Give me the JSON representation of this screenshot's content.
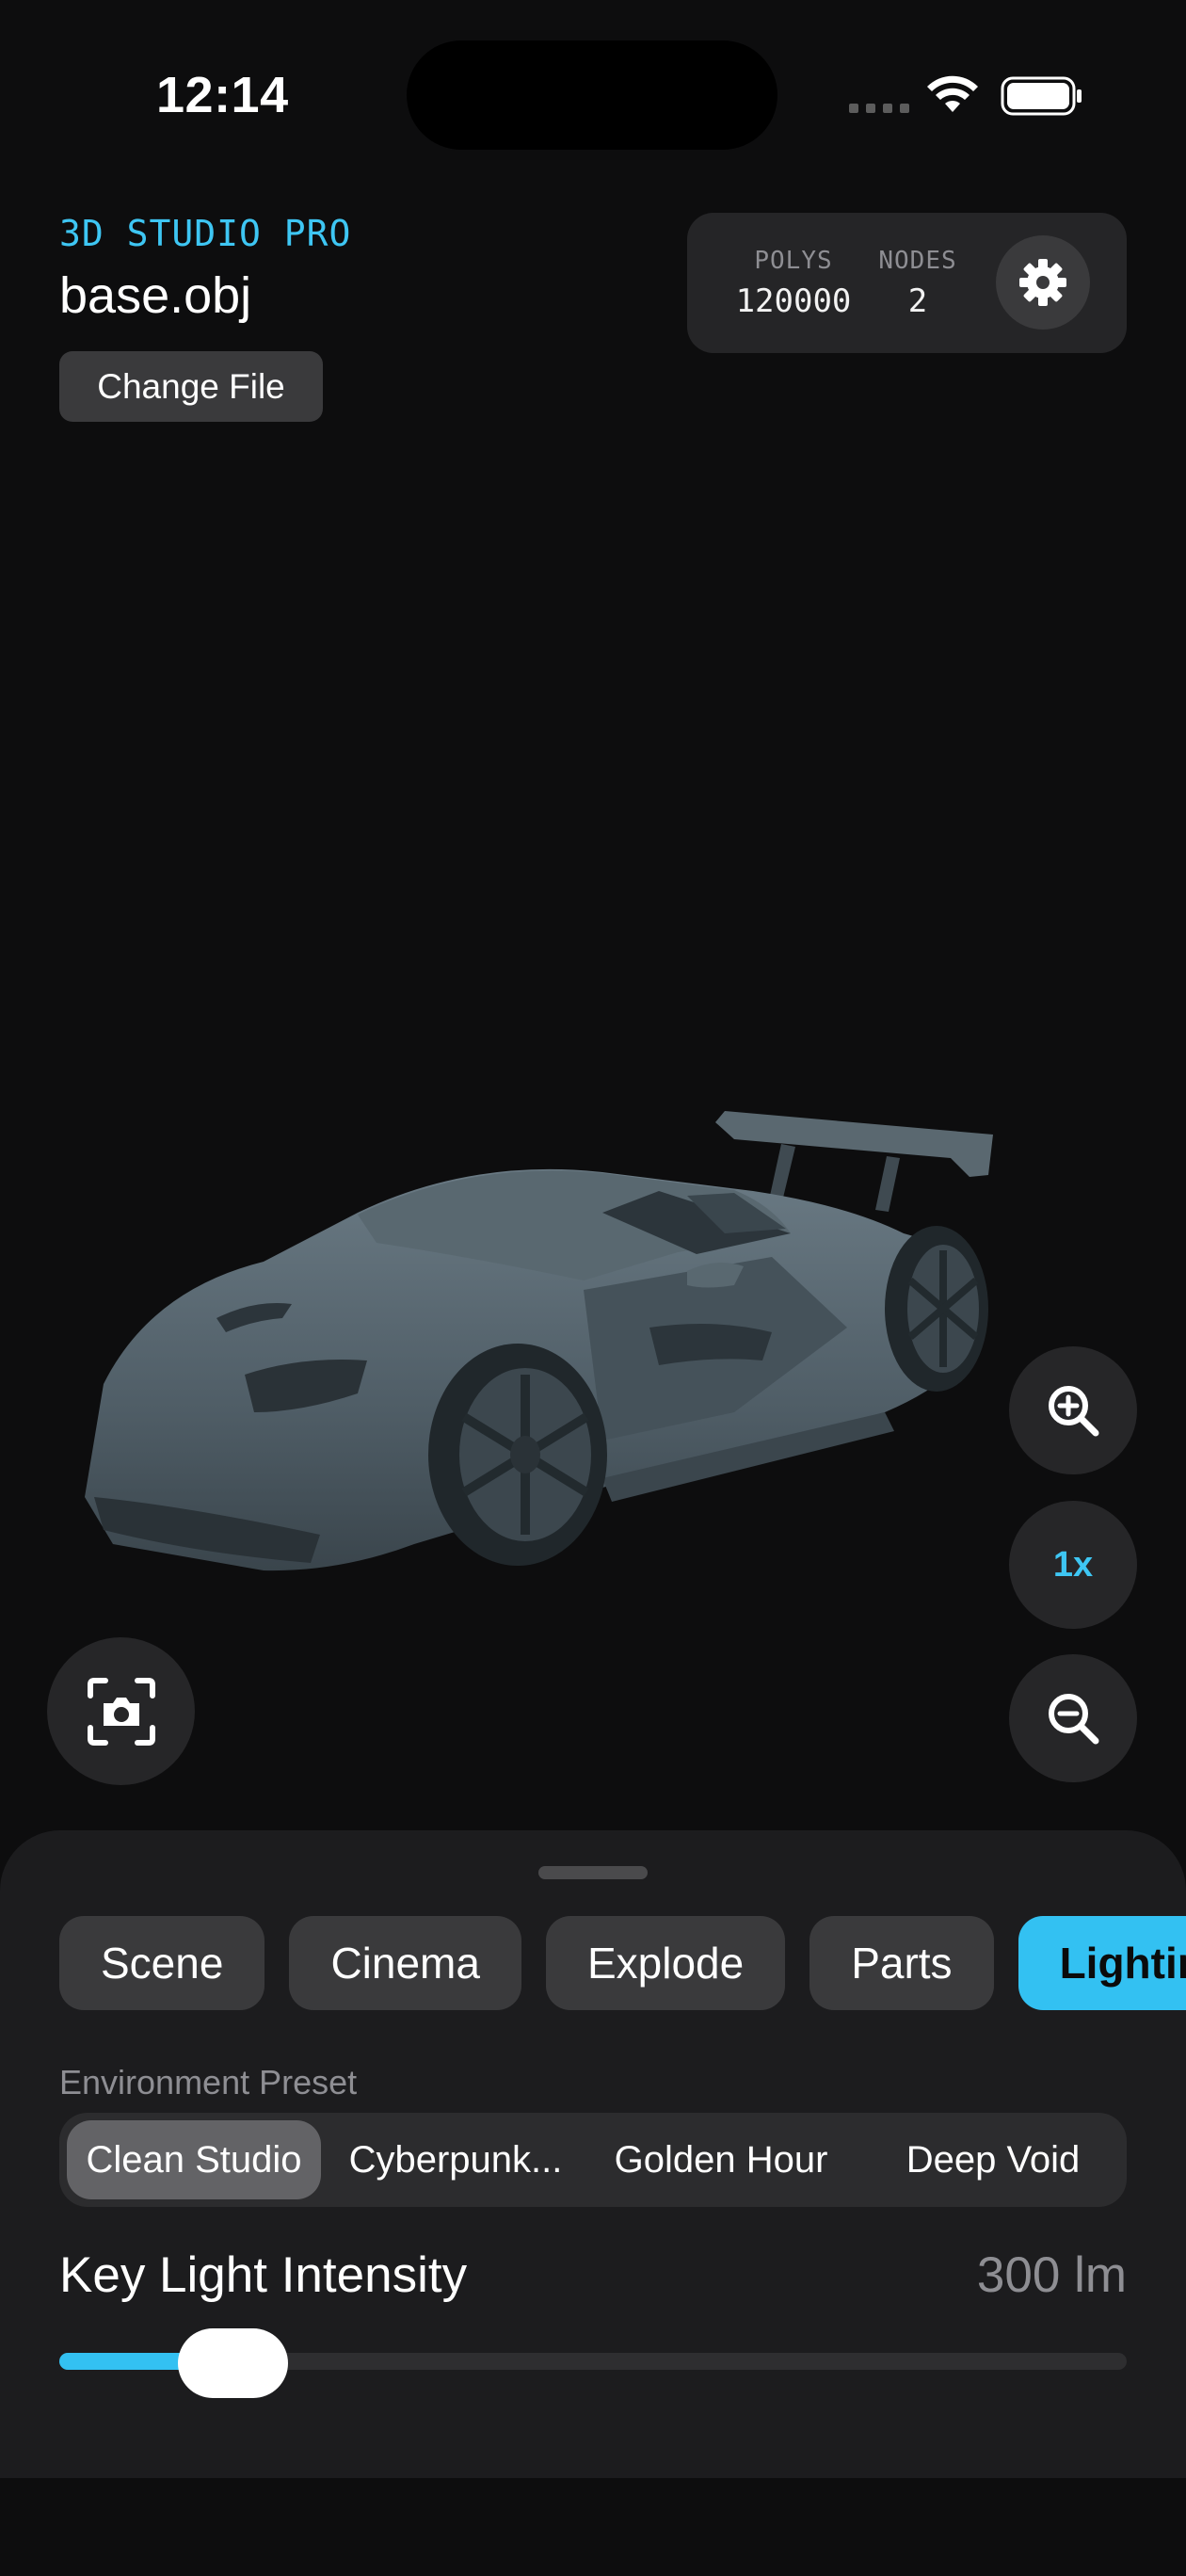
{
  "status_bar": {
    "time": "12:14"
  },
  "header": {
    "app_label": "3D STUDIO PRO",
    "file_name": "base.obj",
    "change_file_label": "Change File"
  },
  "stats": {
    "polys_label": "POLYS",
    "polys_value": "120000",
    "nodes_label": "NODES",
    "nodes_value": "2",
    "settings_icon": "gear-icon"
  },
  "viewport": {
    "model": "sports-car-model",
    "zoom_in_icon": "zoom-in-icon",
    "zoom_level": "1x",
    "zoom_out_icon": "zoom-out-icon",
    "snapshot_icon": "camera-scan-icon"
  },
  "sheet": {
    "tabs": [
      {
        "label": "Scene"
      },
      {
        "label": "Cinema"
      },
      {
        "label": "Explode"
      },
      {
        "label": "Parts"
      },
      {
        "label": "Lighting",
        "active": true
      }
    ],
    "environment_label": "Environment Preset",
    "presets": [
      {
        "label": "Clean Studio",
        "active": true
      },
      {
        "label": "Cyberpunk..."
      },
      {
        "label": "Golden Hour"
      },
      {
        "label": "Deep Void"
      }
    ],
    "slider": {
      "title": "Key Light Intensity",
      "value_text": "300 lm",
      "fraction": 0.11
    }
  },
  "colors": {
    "accent": "#33c1f2",
    "background": "#0d0d0e",
    "sheet": "#1c1c1e",
    "car_body": "#55646d"
  }
}
